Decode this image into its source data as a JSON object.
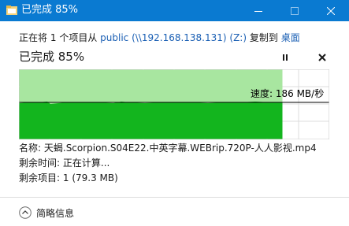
{
  "window": {
    "title": "已完成 85%",
    "colors": {
      "titlebar": "#0a7ad1",
      "graph_fill": "#13b51e",
      "graph_light": "#a8e6a0"
    }
  },
  "copy": {
    "prefix": "正在将",
    "count": "1",
    "items_from": "个项目从",
    "source": "public (\\\\192.168.138.131) (Z:)",
    "copied_to": "复制到",
    "destination": "桌面"
  },
  "progress": {
    "status": "已完成 85%",
    "percent": 85,
    "speed": "速度: 186 MB/秒"
  },
  "details": {
    "name_label": "名称:",
    "name_value": "天蝎.Scorpion.S04E22.中英字幕.WEBrip.720P-人人影视.mp4",
    "time_label": "剩余时间:",
    "time_value": "正在计算...",
    "items_label": "剩余项目:",
    "items_value": "1 (79.3 MB)"
  },
  "footer": {
    "toggle_label": "简略信息"
  },
  "icons": [
    "copy-icon",
    "minimize-icon",
    "maximize-icon",
    "close-icon",
    "pause-icon",
    "cancel-icon",
    "chevron-up-icon"
  ]
}
